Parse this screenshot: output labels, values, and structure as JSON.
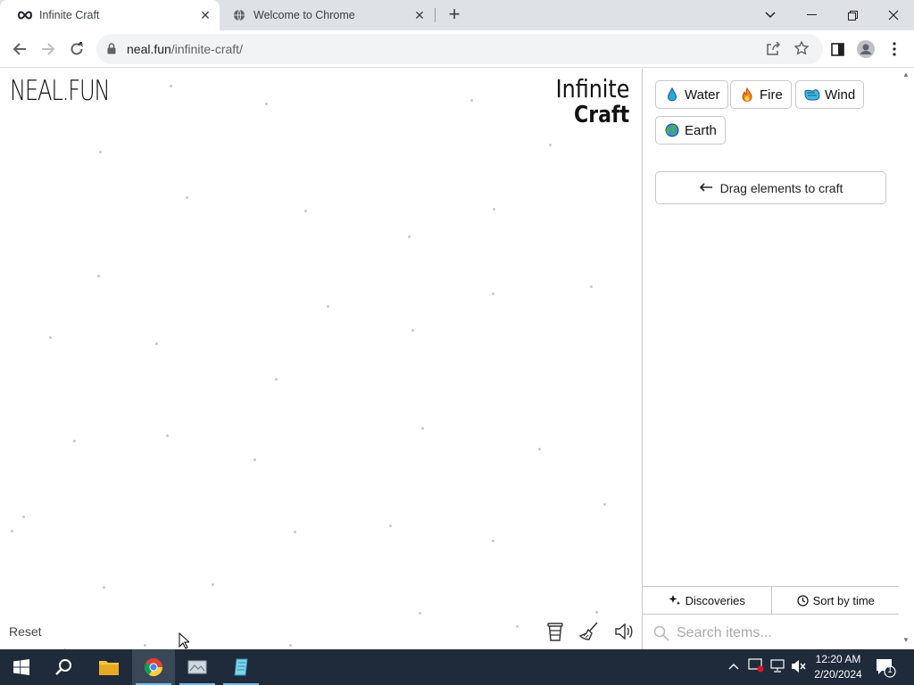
{
  "browser": {
    "tabs": [
      {
        "title": "Infinite Craft",
        "active": true
      },
      {
        "title": "Welcome to Chrome",
        "active": false
      }
    ],
    "new_tab_label": "+",
    "url_host": "neal.fun",
    "url_path": "/infinite-craft/"
  },
  "page": {
    "site_logo": "NEAL.FUN",
    "game_logo_line1": "Infinite",
    "game_logo_line2": "Craft",
    "reset_label": "Reset",
    "elements": [
      {
        "name": "Water",
        "icon": "droplet-icon"
      },
      {
        "name": "Fire",
        "icon": "fire-icon"
      },
      {
        "name": "Wind",
        "icon": "wind-icon"
      },
      {
        "name": "Earth",
        "icon": "globe-icon"
      }
    ],
    "hint": "Drag elements to craft",
    "discoveries_label": "Discoveries",
    "sort_label": "Sort by time",
    "search_placeholder": "Search items..."
  },
  "taskbar": {
    "time": "12:20 AM",
    "date": "2/20/2024",
    "notification_count": "1"
  },
  "colors": {
    "taskbar_bg": "#1f2b3a",
    "tabbar_bg": "#dee1e6",
    "omnibox_bg": "#f1f3f4"
  }
}
